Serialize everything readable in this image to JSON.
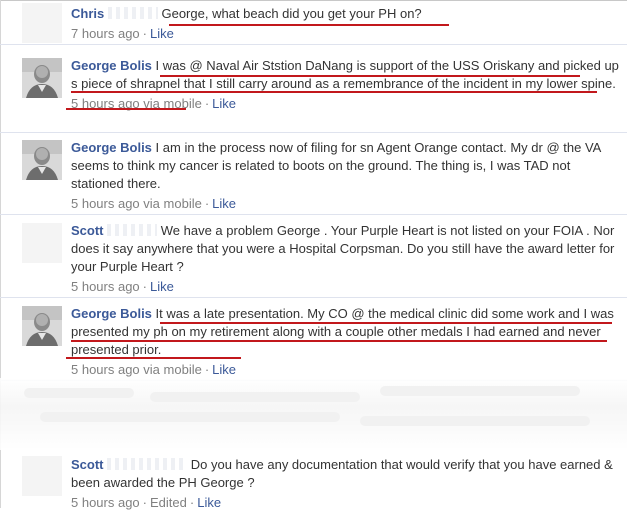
{
  "comments": [
    {
      "author": "Chris",
      "text": "George, what beach did you get your PH on?",
      "timestamp": "7 hours ago",
      "via": "",
      "edited": "",
      "like_label": "Like",
      "separator": "·"
    },
    {
      "author": "George Bolis",
      "text": "I was @ Naval Air Ststion DaNang is support of the USS Oriskany and picked up s piece of shrapnel that I still carry around as a remembrance of the incident in my lower spine.",
      "timestamp": "5 hours ago",
      "via": "via mobile",
      "edited": "",
      "like_label": "Like",
      "separator": "·"
    },
    {
      "author": "George Bolis",
      "text": "I am in the process now of filing for sn Agent Orange contact. My dr @ the VA seems to think my cancer is related to boots on the ground. The thing is, I was TAD not stationed there.",
      "timestamp": "5 hours ago",
      "via": "via mobile",
      "edited": "",
      "like_label": "Like",
      "separator": "·"
    },
    {
      "author": "Scott",
      "text": "We have a problem George . Your Purple Heart is not listed on your FOIA . Nor does it say anywhere that you were a Hospital Corpsman. Do you still have the award letter for your Purple Heart ?",
      "timestamp": "5 hours ago",
      "via": "",
      "edited": "",
      "like_label": "Like",
      "separator": "·"
    },
    {
      "author": "George Bolis",
      "text": "It was a late presentation. My CO @ the medical clinic did some work and I was presented my ph on my retirement along with a couple other medals I had earned and never presented prior.",
      "timestamp": "5 hours ago",
      "via": "via mobile",
      "edited": "",
      "like_label": "Like",
      "separator": "·"
    },
    {
      "author": "Scott",
      "text": "Do you have any documentation that would verify that you have earned & been awarded the PH George ?",
      "timestamp": "5 hours ago",
      "via": "",
      "edited": "Edited",
      "like_label": "Like",
      "separator": "·"
    }
  ],
  "colors": {
    "link_blue": "#3b5998",
    "meta_gray": "#808080",
    "annotation_red": "#c2181c"
  }
}
